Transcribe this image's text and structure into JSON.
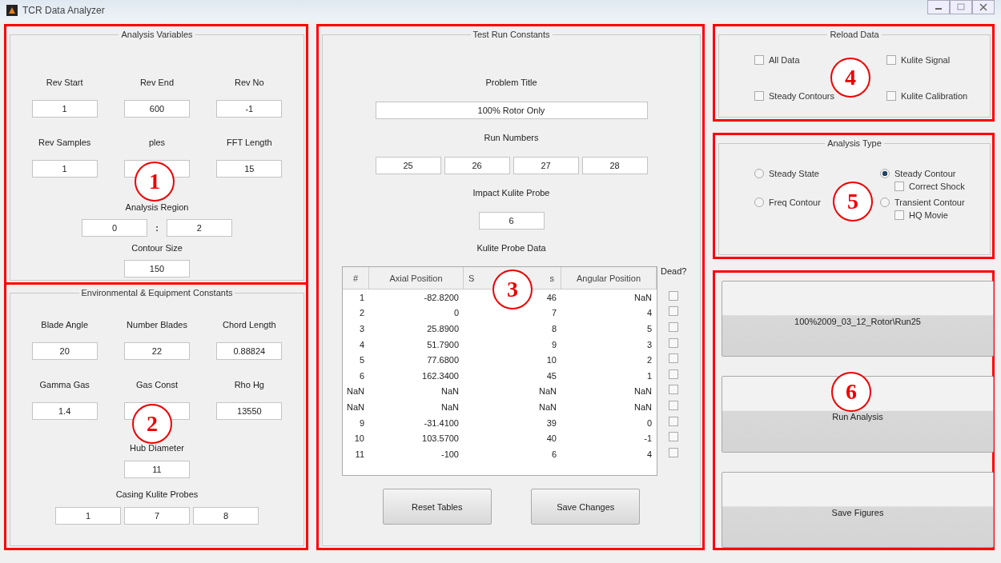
{
  "window": {
    "title": "TCR Data Analyzer"
  },
  "analysis_variables": {
    "title": "Analysis Variables",
    "annotation": "1",
    "fields": [
      {
        "label": "Rev Start",
        "value": "1"
      },
      {
        "label": "Rev End",
        "value": "600"
      },
      {
        "label": "Rev No",
        "value": "-1"
      },
      {
        "label": "Rev Samples",
        "value": "1"
      },
      {
        "label": "ples"
      },
      {
        "label": "FFT Length",
        "value": "15"
      }
    ],
    "region": {
      "label": "Analysis Region",
      "separator": ":",
      "values": [
        "0",
        "2"
      ]
    },
    "contour": {
      "label": "Contour Size",
      "value": "150"
    }
  },
  "environment": {
    "title": "Environmental & Equipment Constants",
    "annotation": "2",
    "fields": [
      {
        "label": "Blade Angle",
        "value": "20"
      },
      {
        "label": "Number Blades",
        "value": "22"
      },
      {
        "label": "Chord Length",
        "value": "0.88824"
      },
      {
        "label": "Gamma Gas",
        "value": "1.4"
      },
      {
        "label": "Gas Const"
      },
      {
        "label": "Rho Hg",
        "value": "13550"
      }
    ],
    "hub": {
      "label": "Hub Diameter",
      "value": "11"
    },
    "probes": {
      "label": "Casing Kulite Probes",
      "values": [
        "1",
        "7",
        "8"
      ]
    }
  },
  "test_run": {
    "title": "Test Run Constants",
    "annotation": "3",
    "problem": {
      "label": "Problem Title",
      "value": "100% Rotor Only"
    },
    "runs": {
      "label": "Run Numbers",
      "values": [
        "25",
        "26",
        "27",
        "28"
      ]
    },
    "impact": {
      "label": "Impact Kulite Probe",
      "value": "6"
    },
    "table_label": "Kulite Probe Data",
    "columns": [
      {
        "label": "#"
      },
      {
        "label": "Axial Position"
      },
      {
        "label": "S",
        "label_end": "s"
      },
      {
        "label": "Angular Position"
      }
    ],
    "dead_label": "Dead?",
    "rows": [
      {
        "cells": [
          "1",
          "-82.8200",
          "46",
          "NaN"
        ],
        "dead": false
      },
      {
        "cells": [
          "2",
          "0",
          "7",
          "4"
        ],
        "dead": false
      },
      {
        "cells": [
          "3",
          "25.8900",
          "8",
          "5"
        ],
        "dead": false
      },
      {
        "cells": [
          "4",
          "51.7900",
          "9",
          "3"
        ],
        "dead": false
      },
      {
        "cells": [
          "5",
          "77.6800",
          "10",
          "2"
        ],
        "dead": false
      },
      {
        "cells": [
          "6",
          "162.3400",
          "45",
          "1"
        ],
        "dead": false
      },
      {
        "cells": [
          "NaN",
          "NaN",
          "NaN",
          "NaN"
        ],
        "dead": false
      },
      {
        "cells": [
          "NaN",
          "NaN",
          "NaN",
          "NaN"
        ],
        "dead": false
      },
      {
        "cells": [
          "9",
          "-31.4100",
          "39",
          "0"
        ],
        "dead": false
      },
      {
        "cells": [
          "10",
          "103.5700",
          "40",
          "-1"
        ],
        "dead": false
      },
      {
        "cells": [
          "11",
          "-100",
          "6",
          "4"
        ],
        "dead": false
      }
    ],
    "buttons": [
      "Reset Tables",
      "Save Changes"
    ]
  },
  "reload": {
    "title": "Reload Data",
    "annotation": "4",
    "options": [
      {
        "label": "All Data",
        "checked": false
      },
      {
        "label": "Kulite Signal",
        "checked": false
      },
      {
        "label": "Steady Contours",
        "checked": false
      },
      {
        "label": "Kulite Calibration",
        "checked": false
      }
    ]
  },
  "analysis_type": {
    "title": "Analysis Type",
    "annotation": "5",
    "options": [
      {
        "label": "Steady State",
        "selected": false
      },
      {
        "label": "Steady Contour",
        "selected": true,
        "sub": {
          "label": "Correct Shock",
          "checked": false
        }
      },
      {
        "label": "Freq Contour",
        "selected": false
      },
      {
        "label": "Transient Contour",
        "selected": false,
        "sub": {
          "label": "HQ Movie",
          "checked": false
        }
      }
    ]
  },
  "actions": {
    "annotation": "6",
    "buttons": [
      "100%2009_03_12_Rotor\\Run25",
      "Run Analysis",
      "Save Figures"
    ]
  }
}
